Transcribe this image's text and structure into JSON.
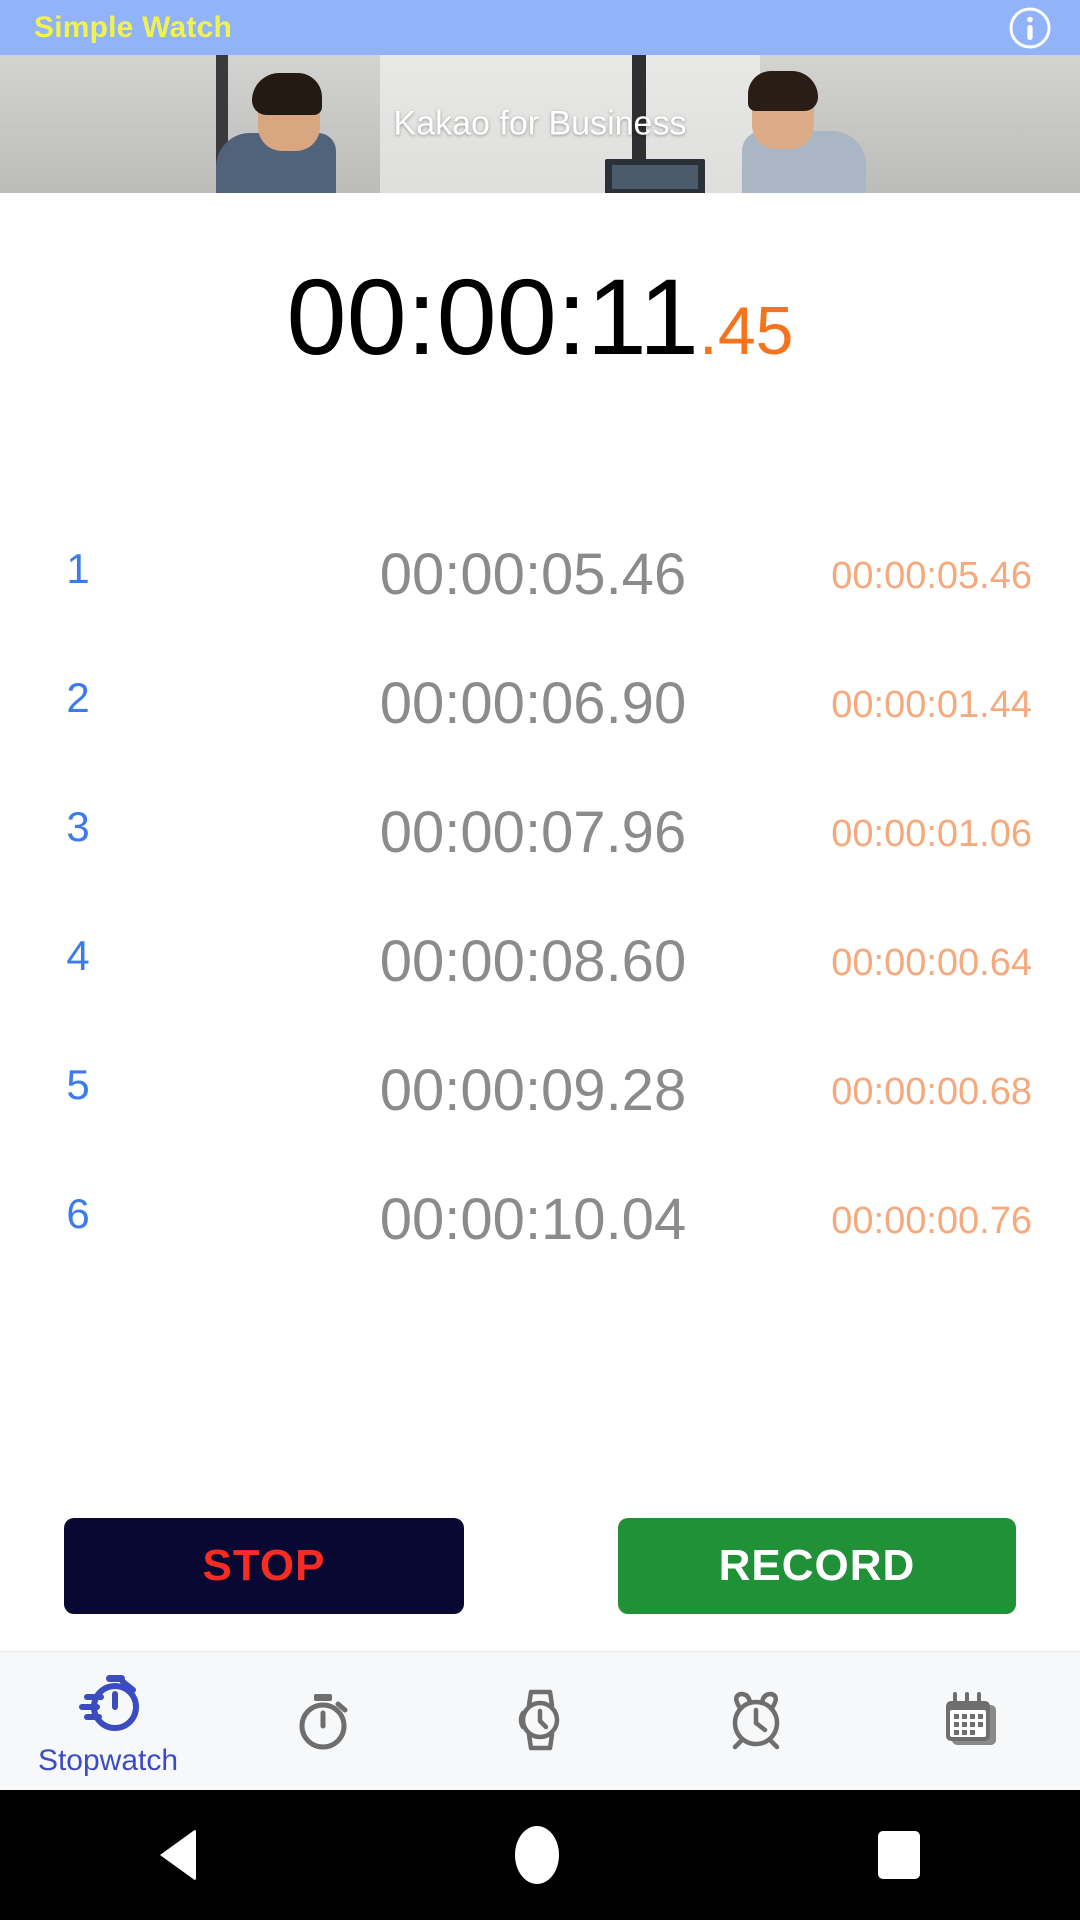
{
  "titlebar": {
    "app_title": "Simple Watch",
    "info_icon": "info-circle-icon"
  },
  "banner": {
    "ad_text": "Kakao for Business"
  },
  "timer": {
    "main": "00:00:11",
    "fraction": ".45",
    "main_color": "#000000",
    "fraction_color": "#F4731C"
  },
  "laps": {
    "rows": [
      {
        "index": "1",
        "time": "00:00:05.46",
        "split": "00:00:05.46"
      },
      {
        "index": "2",
        "time": "00:00:06.90",
        "split": "00:00:01.44"
      },
      {
        "index": "3",
        "time": "00:00:07.96",
        "split": "00:00:01.06"
      },
      {
        "index": "4",
        "time": "00:00:08.60",
        "split": "00:00:00.64"
      },
      {
        "index": "5",
        "time": "00:00:09.28",
        "split": "00:00:00.68"
      },
      {
        "index": "6",
        "time": "00:00:10.04",
        "split": "00:00:00.76"
      }
    ],
    "index_color": "#3B7BEE",
    "time_color": "#8B8B8B",
    "split_color": "#F5A97C"
  },
  "actions": {
    "stop_label": "STOP",
    "record_label": "RECORD",
    "stop_bg": "#080833",
    "stop_fg": "#F92C23",
    "record_bg": "#209137",
    "record_fg": "#FFFFFF"
  },
  "bottomnav": {
    "active_color": "#3B4CC0",
    "inactive_color": "#6E6E6E",
    "items": [
      {
        "label": "Stopwatch",
        "icon": "stopwatch-icon",
        "active": true
      },
      {
        "label": "",
        "icon": "timer-icon",
        "active": false
      },
      {
        "label": "",
        "icon": "wristwatch-icon",
        "active": false
      },
      {
        "label": "",
        "icon": "alarm-clock-icon",
        "active": false
      },
      {
        "label": "",
        "icon": "calendar-icon",
        "active": false
      }
    ]
  },
  "sysnav": {
    "back": "back-triangle-icon",
    "home": "home-circle-icon",
    "recents": "recents-square-icon"
  }
}
